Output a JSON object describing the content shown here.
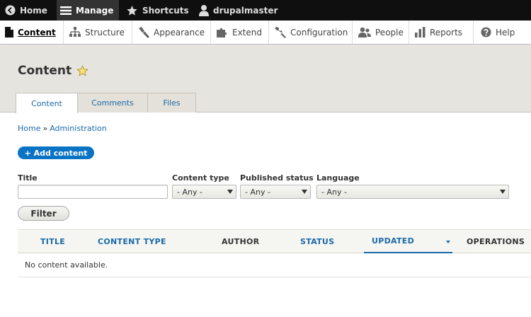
{
  "toolbar": {
    "home": "Home",
    "manage": "Manage",
    "shortcuts": "Shortcuts",
    "user": "drupalmaster"
  },
  "tray": {
    "items": [
      {
        "label": "Content",
        "icon": "file-icon",
        "active": true
      },
      {
        "label": "Structure",
        "icon": "sitemap-icon"
      },
      {
        "label": "Appearance",
        "icon": "paintbrush-icon"
      },
      {
        "label": "Extend",
        "icon": "puzzle-icon"
      },
      {
        "label": "Configuration",
        "icon": "wrench-icon"
      },
      {
        "label": "People",
        "icon": "people-icon"
      },
      {
        "label": "Reports",
        "icon": "bar-chart-icon"
      },
      {
        "label": "Help",
        "icon": "question-icon"
      }
    ]
  },
  "header": {
    "title": "Content",
    "tabs": [
      {
        "label": "Content",
        "active": true
      },
      {
        "label": "Comments"
      },
      {
        "label": "Files"
      }
    ]
  },
  "breadcrumb": {
    "items": [
      "Home",
      "Administration"
    ],
    "separator": "»"
  },
  "actions": {
    "add_content": "+ Add content"
  },
  "filters": {
    "title_label": "Title",
    "title_value": "",
    "content_type_label": "Content type",
    "content_type_value": "- Any -",
    "published_status_label": "Published status",
    "published_status_value": "- Any -",
    "language_label": "Language",
    "language_value": "- Any -",
    "filter_button": "Filter"
  },
  "table": {
    "columns": [
      "TITLE",
      "CONTENT TYPE",
      "AUTHOR",
      "STATUS",
      "UPDATED",
      "OPERATIONS"
    ],
    "sorted_column": "UPDATED",
    "sort_direction": "descending",
    "empty_text": "No content available."
  },
  "colors": {
    "link": "#1a6aa8",
    "primary_button": "#0a74c4",
    "toolbar_bg": "#0f0f0f",
    "header_bg": "#e6e4df"
  }
}
